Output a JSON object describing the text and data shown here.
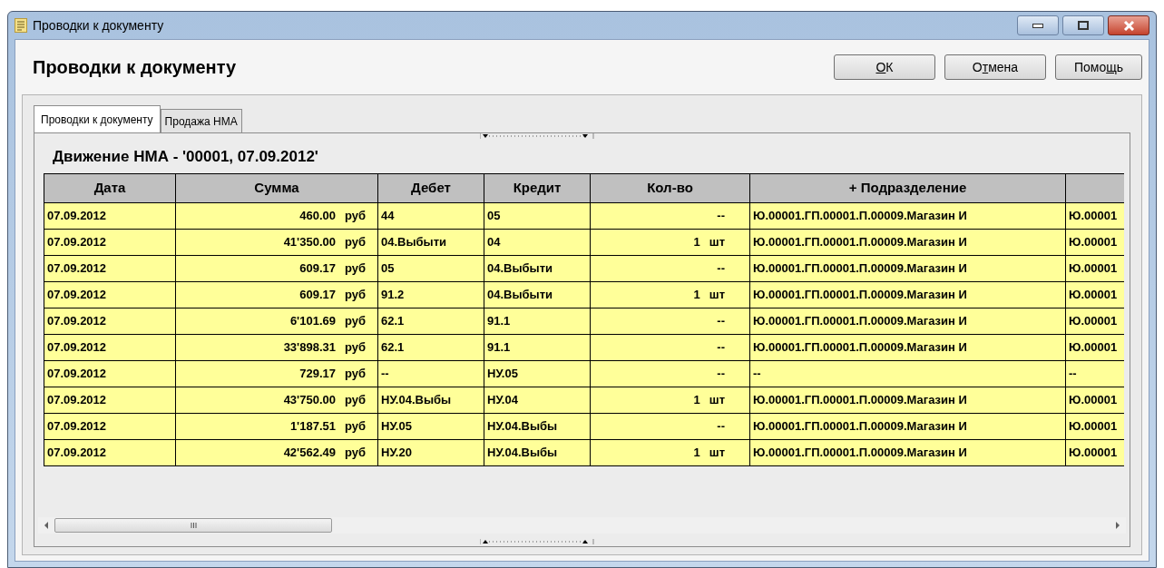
{
  "window": {
    "title": "Проводки к документу"
  },
  "heading": "Проводки к документу",
  "buttons": [
    {
      "label": "ОК"
    },
    {
      "label": "Отмена"
    },
    {
      "label": "Помощь"
    }
  ],
  "tabs": [
    {
      "label": "Проводки к документу",
      "selected": true
    },
    {
      "label": "Продажа НМА",
      "selected": false
    }
  ],
  "section_title": "Движение НМА - '00001, 07.09.2012'",
  "table": {
    "columns": [
      "Дата",
      "Сумма",
      "Дебет",
      "Кредит",
      "Кол-во",
      "+ Подразделение"
    ],
    "rows": [
      {
        "date": "07.09.2012",
        "amount": "460.00",
        "currency": "руб",
        "debit": "44",
        "credit": "05",
        "qty": "--",
        "division": "Ю.00001.ГП.00001.П.00009.Магазин И",
        "column_7": "Ю.00001"
      },
      {
        "date": "07.09.2012",
        "amount": "41'350.00",
        "currency": "руб",
        "debit": "04.Выбыти",
        "credit": "04",
        "qty": "1",
        "unit": "шт",
        "division": "Ю.00001.ГП.00001.П.00009.Магазин И",
        "column_7": "Ю.00001"
      },
      {
        "date": "07.09.2012",
        "amount": "609.17",
        "currency": "руб",
        "debit": "05",
        "credit": "04.Выбыти",
        "qty": "--",
        "division": "Ю.00001.ГП.00001.П.00009.Магазин И",
        "column_7": "Ю.00001"
      },
      {
        "date": "07.09.2012",
        "amount": "609.17",
        "currency": "руб",
        "debit": "91.2",
        "credit": "04.Выбыти",
        "qty": "1",
        "unit": "шт",
        "division": "Ю.00001.ГП.00001.П.00009.Магазин И",
        "column_7": "Ю.00001"
      },
      {
        "date": "07.09.2012",
        "amount": "6'101.69",
        "currency": "руб",
        "debit": "62.1",
        "credit": "91.1",
        "qty": "--",
        "division": "Ю.00001.ГП.00001.П.00009.Магазин И",
        "column_7": "Ю.00001"
      },
      {
        "date": "07.09.2012",
        "amount": "33'898.31",
        "currency": "руб",
        "debit": "62.1",
        "credit": "91.1",
        "qty": "--",
        "division": "Ю.00001.ГП.00001.П.00009.Магазин И",
        "column_7": "Ю.00001"
      },
      {
        "date": "07.09.2012",
        "amount": "729.17",
        "currency": "руб",
        "debit": "--",
        "credit": "НУ.05",
        "qty": "--",
        "division": "--",
        "column_7": "--"
      },
      {
        "date": "07.09.2012",
        "amount": "43'750.00",
        "currency": "руб",
        "debit": "НУ.04.Выбы",
        "credit": "НУ.04",
        "qty": "1",
        "unit": "шт",
        "division": "Ю.00001.ГП.00001.П.00009.Магазин И",
        "column_7": "Ю.00001"
      },
      {
        "date": "07.09.2012",
        "amount": "1'187.51",
        "currency": "руб",
        "debit": "НУ.05",
        "credit": "НУ.04.Выбы",
        "qty": "--",
        "division": "Ю.00001.ГП.00001.П.00009.Магазин И",
        "column_7": "Ю.00001"
      },
      {
        "date": "07.09.2012",
        "amount": "42'562.49",
        "currency": "руб",
        "debit": "НУ.20",
        "credit": "НУ.04.Выбы",
        "qty": "1",
        "unit": "шт",
        "division": "Ю.00001.ГП.00001.П.00009.Магазин И",
        "column_7": "Ю.00001"
      }
    ]
  }
}
